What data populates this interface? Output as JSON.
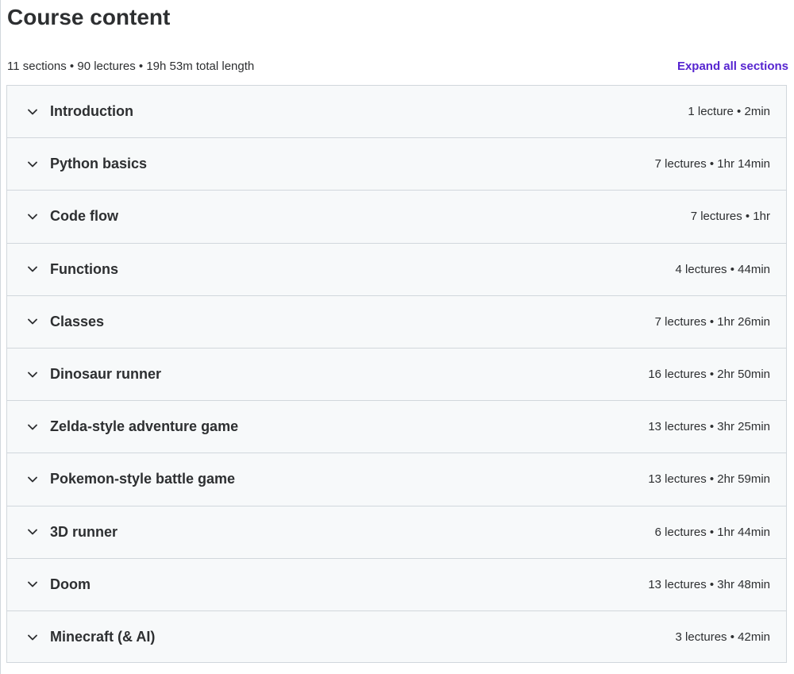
{
  "page": {
    "title": "Course content"
  },
  "summary": {
    "text": "11 sections • 90 lectures • 19h 53m total length",
    "expand_label": "Expand all sections"
  },
  "colors": {
    "accent": "#5624d0",
    "text": "#2d2f31",
    "panel_bg": "#f7f9fa",
    "border": "#d1d7dc"
  },
  "icons": {
    "section_toggle": "chevron-down-icon"
  },
  "sections": [
    {
      "title": "Introduction",
      "meta": "1 lecture • 2min"
    },
    {
      "title": "Python basics",
      "meta": "7 lectures • 1hr 14min"
    },
    {
      "title": "Code flow",
      "meta": "7 lectures • 1hr"
    },
    {
      "title": "Functions",
      "meta": "4 lectures • 44min"
    },
    {
      "title": "Classes",
      "meta": "7 lectures • 1hr 26min"
    },
    {
      "title": "Dinosaur runner",
      "meta": "16 lectures • 2hr 50min"
    },
    {
      "title": "Zelda-style adventure game",
      "meta": "13 lectures • 3hr 25min"
    },
    {
      "title": "Pokemon-style battle game",
      "meta": "13 lectures • 2hr 59min"
    },
    {
      "title": "3D runner",
      "meta": "6 lectures • 1hr 44min"
    },
    {
      "title": "Doom",
      "meta": "13 lectures • 3hr 48min"
    },
    {
      "title": "Minecraft (& AI)",
      "meta": "3 lectures • 42min"
    }
  ]
}
